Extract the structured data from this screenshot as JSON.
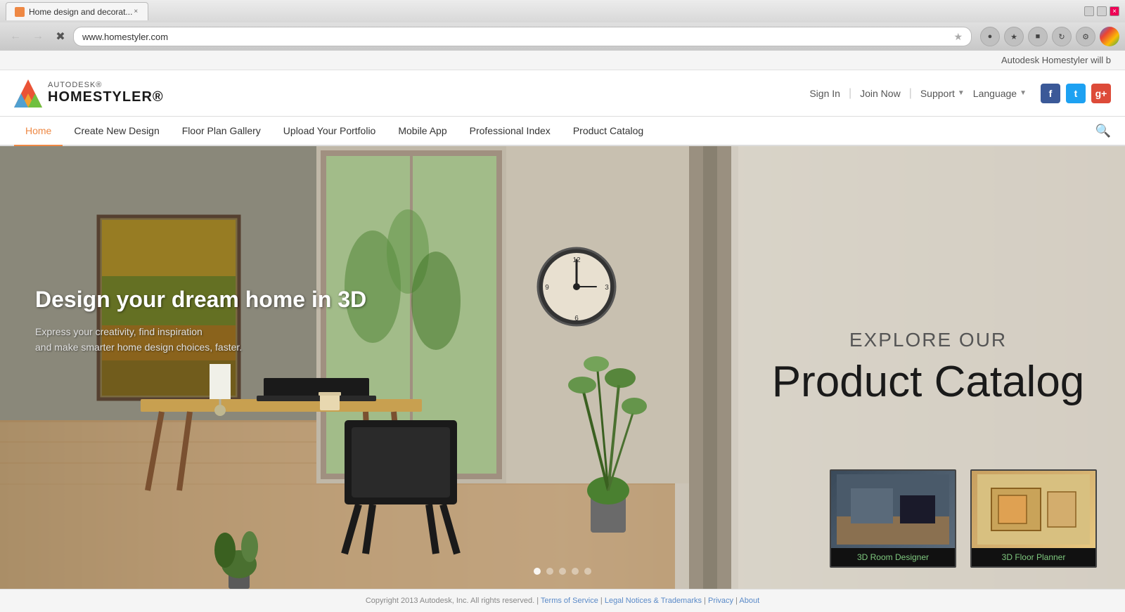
{
  "browser": {
    "tab_title": "Home design and decorat...",
    "url": "www.homestyler.com",
    "win_close_label": "×",
    "win_minimize_label": "−",
    "win_maximize_label": "□"
  },
  "announcement": {
    "text": "Autodesk Homestyler will b"
  },
  "header": {
    "autodesk_label": "AUTODESK®",
    "brand_label": "HOMESTYLER®",
    "signin_label": "Sign In",
    "joinnow_label": "Join Now",
    "support_label": "Support",
    "language_label": "Language",
    "facebook_label": "f",
    "twitter_label": "t",
    "gplus_label": "g+"
  },
  "nav": {
    "items": [
      {
        "label": "Home",
        "active": true
      },
      {
        "label": "Create New Design",
        "active": false
      },
      {
        "label": "Floor Plan Gallery",
        "active": false
      },
      {
        "label": "Upload Your Portfolio",
        "active": false
      },
      {
        "label": "Mobile App",
        "active": false
      },
      {
        "label": "Professional Index",
        "active": false
      },
      {
        "label": "Product Catalog",
        "active": false
      }
    ]
  },
  "hero": {
    "headline": "Design your dream home in 3D",
    "subline1": "Express your creativity, find inspiration",
    "subline2": "and make smarter home design choices, faster.",
    "explore_label": "EXPLORE OUR",
    "catalog_title": "Product Catalog",
    "thumb1_label": "3D Room Designer",
    "thumb2_label": "3D Floor Planner"
  },
  "footer": {
    "copyright": "Copyright 2013 Autodesk, Inc. All rights reserved.",
    "terms_label": "Terms of Service",
    "legal_label": "Legal Notices & Trademarks",
    "privacy_label": "Privacy",
    "about_label": "About"
  },
  "slider": {
    "dots": [
      "dot1",
      "dot2",
      "dot3",
      "dot4",
      "dot5"
    ]
  }
}
